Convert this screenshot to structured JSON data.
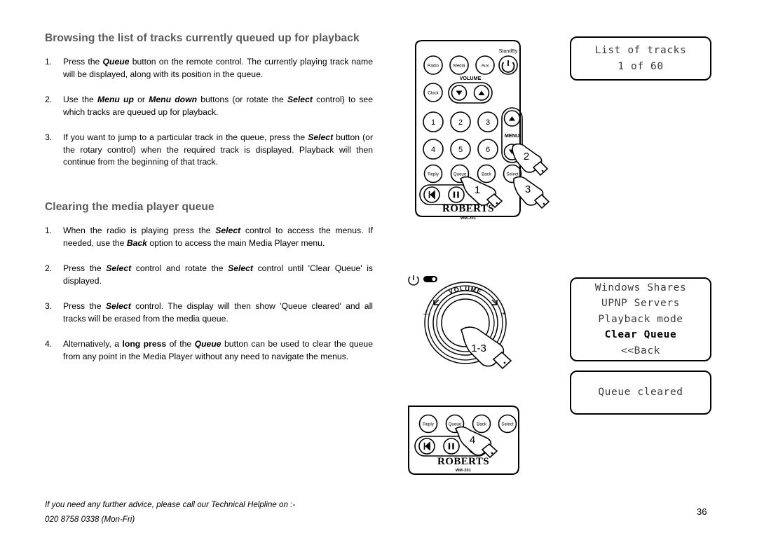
{
  "document": {
    "page_number": "36",
    "footer_line1": "If you need any further advice, please call our Technical Helpline on :-",
    "footer_line2": "020 8758 0338 (Mon-Fri)"
  },
  "sections": [
    {
      "heading": "Browsing the list of tracks currently queued up for playback",
      "steps": [
        {
          "num": "1.",
          "parts": [
            {
              "t": "Press the ",
              "s": "n"
            },
            {
              "t": "Queue",
              "s": "bi"
            },
            {
              "t": " button on the remote control. The currently playing track name will be displayed, along with its position in the queue.",
              "s": "n"
            }
          ]
        },
        {
          "num": "2.",
          "parts": [
            {
              "t": "Use the ",
              "s": "n"
            },
            {
              "t": "Menu up",
              "s": "bi"
            },
            {
              "t": " or ",
              "s": "n"
            },
            {
              "t": "Menu down",
              "s": "bi"
            },
            {
              "t": " buttons (or rotate the ",
              "s": "n"
            },
            {
              "t": "Select",
              "s": "bi"
            },
            {
              "t": " control) to see which tracks are queued up for playback.",
              "s": "n"
            }
          ]
        },
        {
          "num": "3.",
          "parts": [
            {
              "t": "If you want to jump to a particular track in the queue, press the ",
              "s": "n"
            },
            {
              "t": "Select",
              "s": "bi"
            },
            {
              "t": " button (or the rotary control) when the required track is displayed. Playback will then continue from the beginning of that track.",
              "s": "n"
            }
          ]
        }
      ]
    },
    {
      "heading": "Clearing the media player queue",
      "steps": [
        {
          "num": "1.",
          "parts": [
            {
              "t": "When the radio is playing press the ",
              "s": "n"
            },
            {
              "t": "Select",
              "s": "bi"
            },
            {
              "t": " control to access the menus.  If needed, use the ",
              "s": "n"
            },
            {
              "t": "Back",
              "s": "bi"
            },
            {
              "t": " option to access the main Media Player menu.",
              "s": "n"
            }
          ]
        },
        {
          "num": "2.",
          "parts": [
            {
              "t": "Press the ",
              "s": "n"
            },
            {
              "t": "Select",
              "s": "bi"
            },
            {
              "t": " control and rotate the ",
              "s": "n"
            },
            {
              "t": "Select",
              "s": "bi"
            },
            {
              "t": " control until 'Clear Queue' is displayed.",
              "s": "n"
            }
          ]
        },
        {
          "num": "3.",
          "parts": [
            {
              "t": "Press the ",
              "s": "n"
            },
            {
              "t": "Select",
              "s": "bi"
            },
            {
              "t": " control. The display will then show 'Queue cleared' and all tracks will be erased from the media queue.",
              "s": "n"
            }
          ]
        },
        {
          "num": "4.",
          "parts": [
            {
              "t": "Alternatively, a ",
              "s": "n"
            },
            {
              "t": "long press",
              "s": "b"
            },
            {
              "t": " of the ",
              "s": "n"
            },
            {
              "t": "Queue",
              "s": "bi"
            },
            {
              "t": " button can be used to clear the queue from any point in the Media Player without any need to navigate the menus.",
              "s": "n"
            }
          ]
        }
      ]
    }
  ],
  "displays": {
    "tracks": {
      "lines": [
        {
          "text": "List of tracks",
          "highlight": false
        },
        {
          "text": "1 of 60",
          "highlight": false
        }
      ]
    },
    "menu": {
      "lines": [
        {
          "text": "Windows Shares",
          "highlight": false
        },
        {
          "text": "UPNP Servers",
          "highlight": false
        },
        {
          "text": "Playback mode",
          "highlight": false
        },
        {
          "text": "Clear Queue",
          "highlight": true
        },
        {
          "text": "<<Back",
          "highlight": false
        }
      ]
    },
    "cleared": {
      "lines": [
        {
          "text": "Queue cleared",
          "highlight": false
        }
      ]
    }
  },
  "remote": {
    "brand": "ROBERTS",
    "model": "WM-201",
    "standby_label": "StandBy",
    "volume_label": "VOLUME",
    "menu_label": "MENU",
    "source_buttons": [
      "Radio",
      "Media",
      "Aux"
    ],
    "clock_button": "Clock",
    "numeric_buttons": [
      "1",
      "2",
      "3",
      "4",
      "5",
      "6"
    ],
    "function_buttons": [
      "Reply",
      "Queue",
      "Back",
      "Select"
    ],
    "hand_callouts": [
      "1",
      "2",
      "3"
    ]
  },
  "knob": {
    "volume_label": "VOLUME",
    "minus": "−",
    "plus": "+",
    "hand_callout": "1-3"
  },
  "remote_bottom": {
    "brand": "ROBERTS",
    "model": "WM-201",
    "function_buttons": [
      "Reply",
      "Queue",
      "Back",
      "Select"
    ],
    "hand_callout": "4"
  }
}
